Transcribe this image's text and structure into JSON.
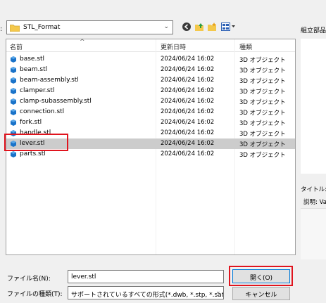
{
  "location": {
    "folder": "STL_Format"
  },
  "right_pane": {
    "label": "組立部品",
    "title_label": "タイトル: V",
    "desc_label": "説明: Va"
  },
  "list": {
    "columns": {
      "name": "名前",
      "modified": "更新日時",
      "type": "種類"
    },
    "rows": [
      {
        "name": "base.stl",
        "modified": "2024/06/24 16:02",
        "type": "3D オブジェクト"
      },
      {
        "name": "beam.stl",
        "modified": "2024/06/24 16:02",
        "type": "3D オブジェクト"
      },
      {
        "name": "beam-assembly.stl",
        "modified": "2024/06/24 16:02",
        "type": "3D オブジェクト"
      },
      {
        "name": "clamper.stl",
        "modified": "2024/06/24 16:02",
        "type": "3D オブジェクト"
      },
      {
        "name": "clamp-subassembly.stl",
        "modified": "2024/06/24 16:02",
        "type": "3D オブジェクト"
      },
      {
        "name": "connection.stl",
        "modified": "2024/06/24 16:02",
        "type": "3D オブジェクト"
      },
      {
        "name": "fork.stl",
        "modified": "2024/06/24 16:02",
        "type": "3D オブジェクト"
      },
      {
        "name": "handle.stl",
        "modified": "2024/06/24 16:02",
        "type": "3D オブジェクト"
      },
      {
        "name": "lever.stl",
        "modified": "2024/06/24 16:02",
        "type": "3D オブジェクト"
      },
      {
        "name": "parts.stl",
        "modified": "2024/06/24 16:02",
        "type": "3D オブジェクト"
      }
    ],
    "selected_row": "lever.stl"
  },
  "footer": {
    "filename_label": "ファイル名(N):",
    "filename_value": "lever.stl",
    "filetype_label": "ファイルの種類(T):",
    "filetype_value": "サポートされているすべての形式(*.dwb, *.stp, *.sat, *.s",
    "open_label": "開く(O)",
    "cancel_label": "キャンセル"
  },
  "colors": {
    "highlight_red": "#e0141e",
    "selection": "#cccccc",
    "accent": "#0078d7"
  }
}
